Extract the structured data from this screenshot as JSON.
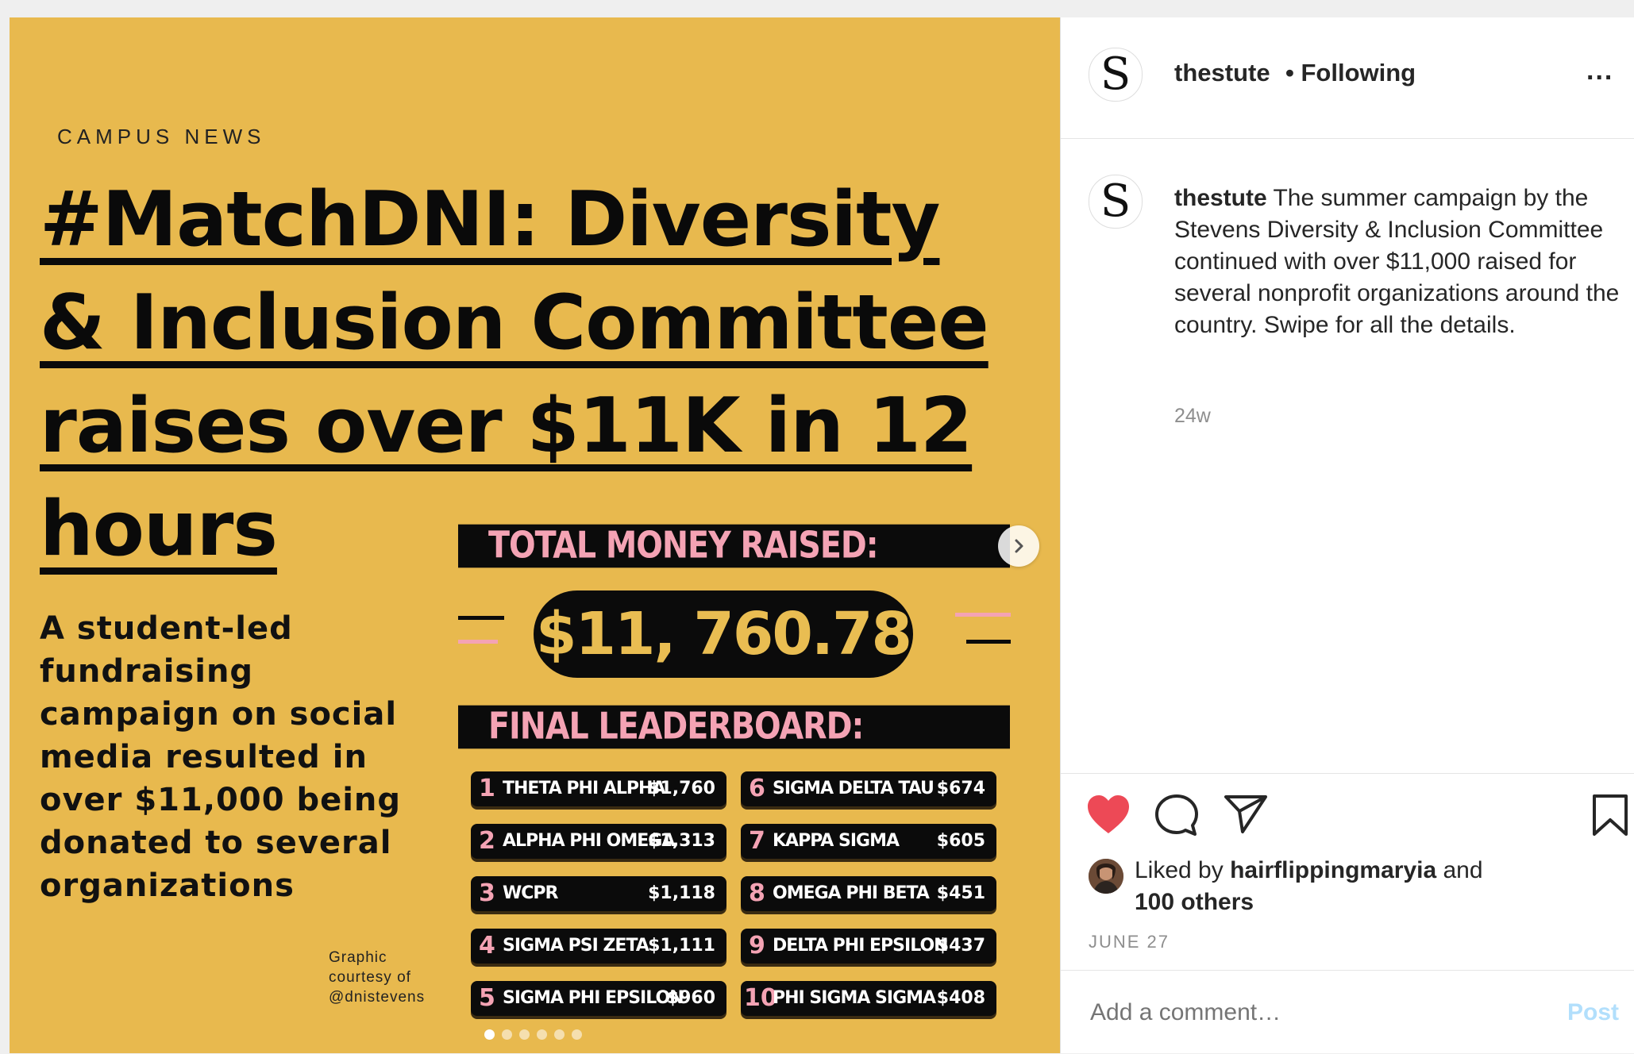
{
  "media": {
    "kicker": "CAMPUS NEWS",
    "headline": "#MatchDNI: Diversity & Inclusion Committee raises over $11K in 12 hours",
    "subtext": "A student-led fundraising campaign on social media resulted in over $11,000 being donated to several organizations",
    "credit": "Graphic courtesy of @dnistevens",
    "total_label": "TOTAL MONEY RAISED:",
    "total_value": "$11, 760.78",
    "leaderboard_label": "FINAL LEADERBOARD:",
    "leaderboard": [
      {
        "rank": "1",
        "name": "THETA PHI ALPHA",
        "amount": "$1,760"
      },
      {
        "rank": "2",
        "name": "ALPHA PHI OMEGA",
        "amount": "$1,313"
      },
      {
        "rank": "3",
        "name": "WCPR",
        "amount": "$1,118"
      },
      {
        "rank": "4",
        "name": "SIGMA PSI ZETA",
        "amount": "$1,111"
      },
      {
        "rank": "5",
        "name": "SIGMA PHI EPSILON",
        "amount": "$960"
      },
      {
        "rank": "6",
        "name": "SIGMA DELTA TAU",
        "amount": "$674"
      },
      {
        "rank": "7",
        "name": "KAPPA SIGMA",
        "amount": "$605"
      },
      {
        "rank": "8",
        "name": "OMEGA PHI BETA",
        "amount": "$451"
      },
      {
        "rank": "9",
        "name": "DELTA PHI EPSILON",
        "amount": "$437"
      },
      {
        "rank": "10",
        "name": "PHI SIGMA SIGMA",
        "amount": "$408"
      }
    ],
    "carousel": {
      "count": 6,
      "active_index": 0
    },
    "colors": {
      "background": "#e8b94e",
      "accent_pink": "#f4a3b4",
      "black": "#0b0b0b"
    }
  },
  "header": {
    "avatar_letter": "S",
    "username": "thestute",
    "separator": "•",
    "follow_status": "Following",
    "more_label": "..."
  },
  "caption": {
    "avatar_letter": "S",
    "username": "thestute",
    "text": "The summer campaign by the Stevens Diversity & Inclusion Committee continued with over $11,000 raised for several nonprofit organizations around the country. Swipe for all the details.",
    "age": "24w"
  },
  "actions": {
    "liked_prefix": "Liked by",
    "liked_user": "hairflippingmaryia",
    "liked_and": "and",
    "liked_others": "100 others",
    "date": "JUNE 27",
    "like_state": "liked",
    "icons": [
      "heart-icon",
      "comment-icon",
      "share-icon",
      "bookmark-icon"
    ],
    "heart_color": "#ed4956"
  },
  "comment": {
    "placeholder": "Add a comment…",
    "post_label": "Post"
  }
}
